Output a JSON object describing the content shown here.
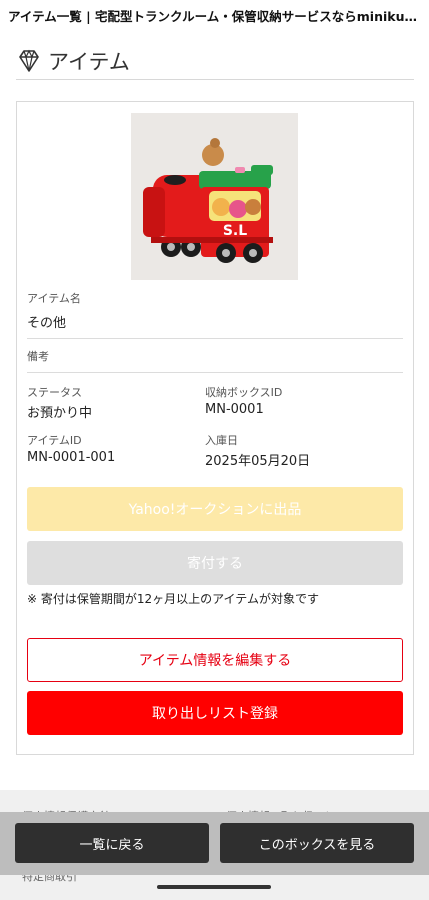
{
  "browser": {
    "page_title": "アイテム一覧 | 宅配型トランクルーム・保管収納サービスならminikura（ミニクラ）"
  },
  "header": {
    "title": "アイテム",
    "icon": "diamond-icon"
  },
  "item": {
    "name_label": "アイテム名",
    "name_value": "その他",
    "remarks_label": "備考",
    "remarks_value": "",
    "status_label": "ステータス",
    "status_value": "お預かり中",
    "box_id_label": "収納ボックスID",
    "box_id_value": "MN-0001",
    "item_id_label": "アイテムID",
    "item_id_value": "MN-0001-001",
    "entry_date_label": "入庫日",
    "entry_date_value": "2025年05月20日",
    "photo_text": "S.L"
  },
  "actions": {
    "yahoo_label": "Yahoo!オークションに出品",
    "donate_label": "寄付する",
    "donate_note": "※ 寄付は保管期間が12ヶ月以上のアイテムが対象です",
    "edit_label": "アイテム情報を編集する",
    "retrieve_label": "取り出しリスト登録"
  },
  "footer": {
    "link_privacy": "個人情報保護方針",
    "link_handling": "個人情報の取り扱いについて",
    "link_third": "特定商取引"
  },
  "bottom_nav": {
    "back_label": "一覧に戻る",
    "box_label": "このボックスを見る"
  },
  "colors": {
    "accent_red": "#ff0000",
    "yahoo_disabled": "#fde9a8",
    "donate_disabled": "#dedede",
    "bottom_button": "#2f2f2f"
  }
}
